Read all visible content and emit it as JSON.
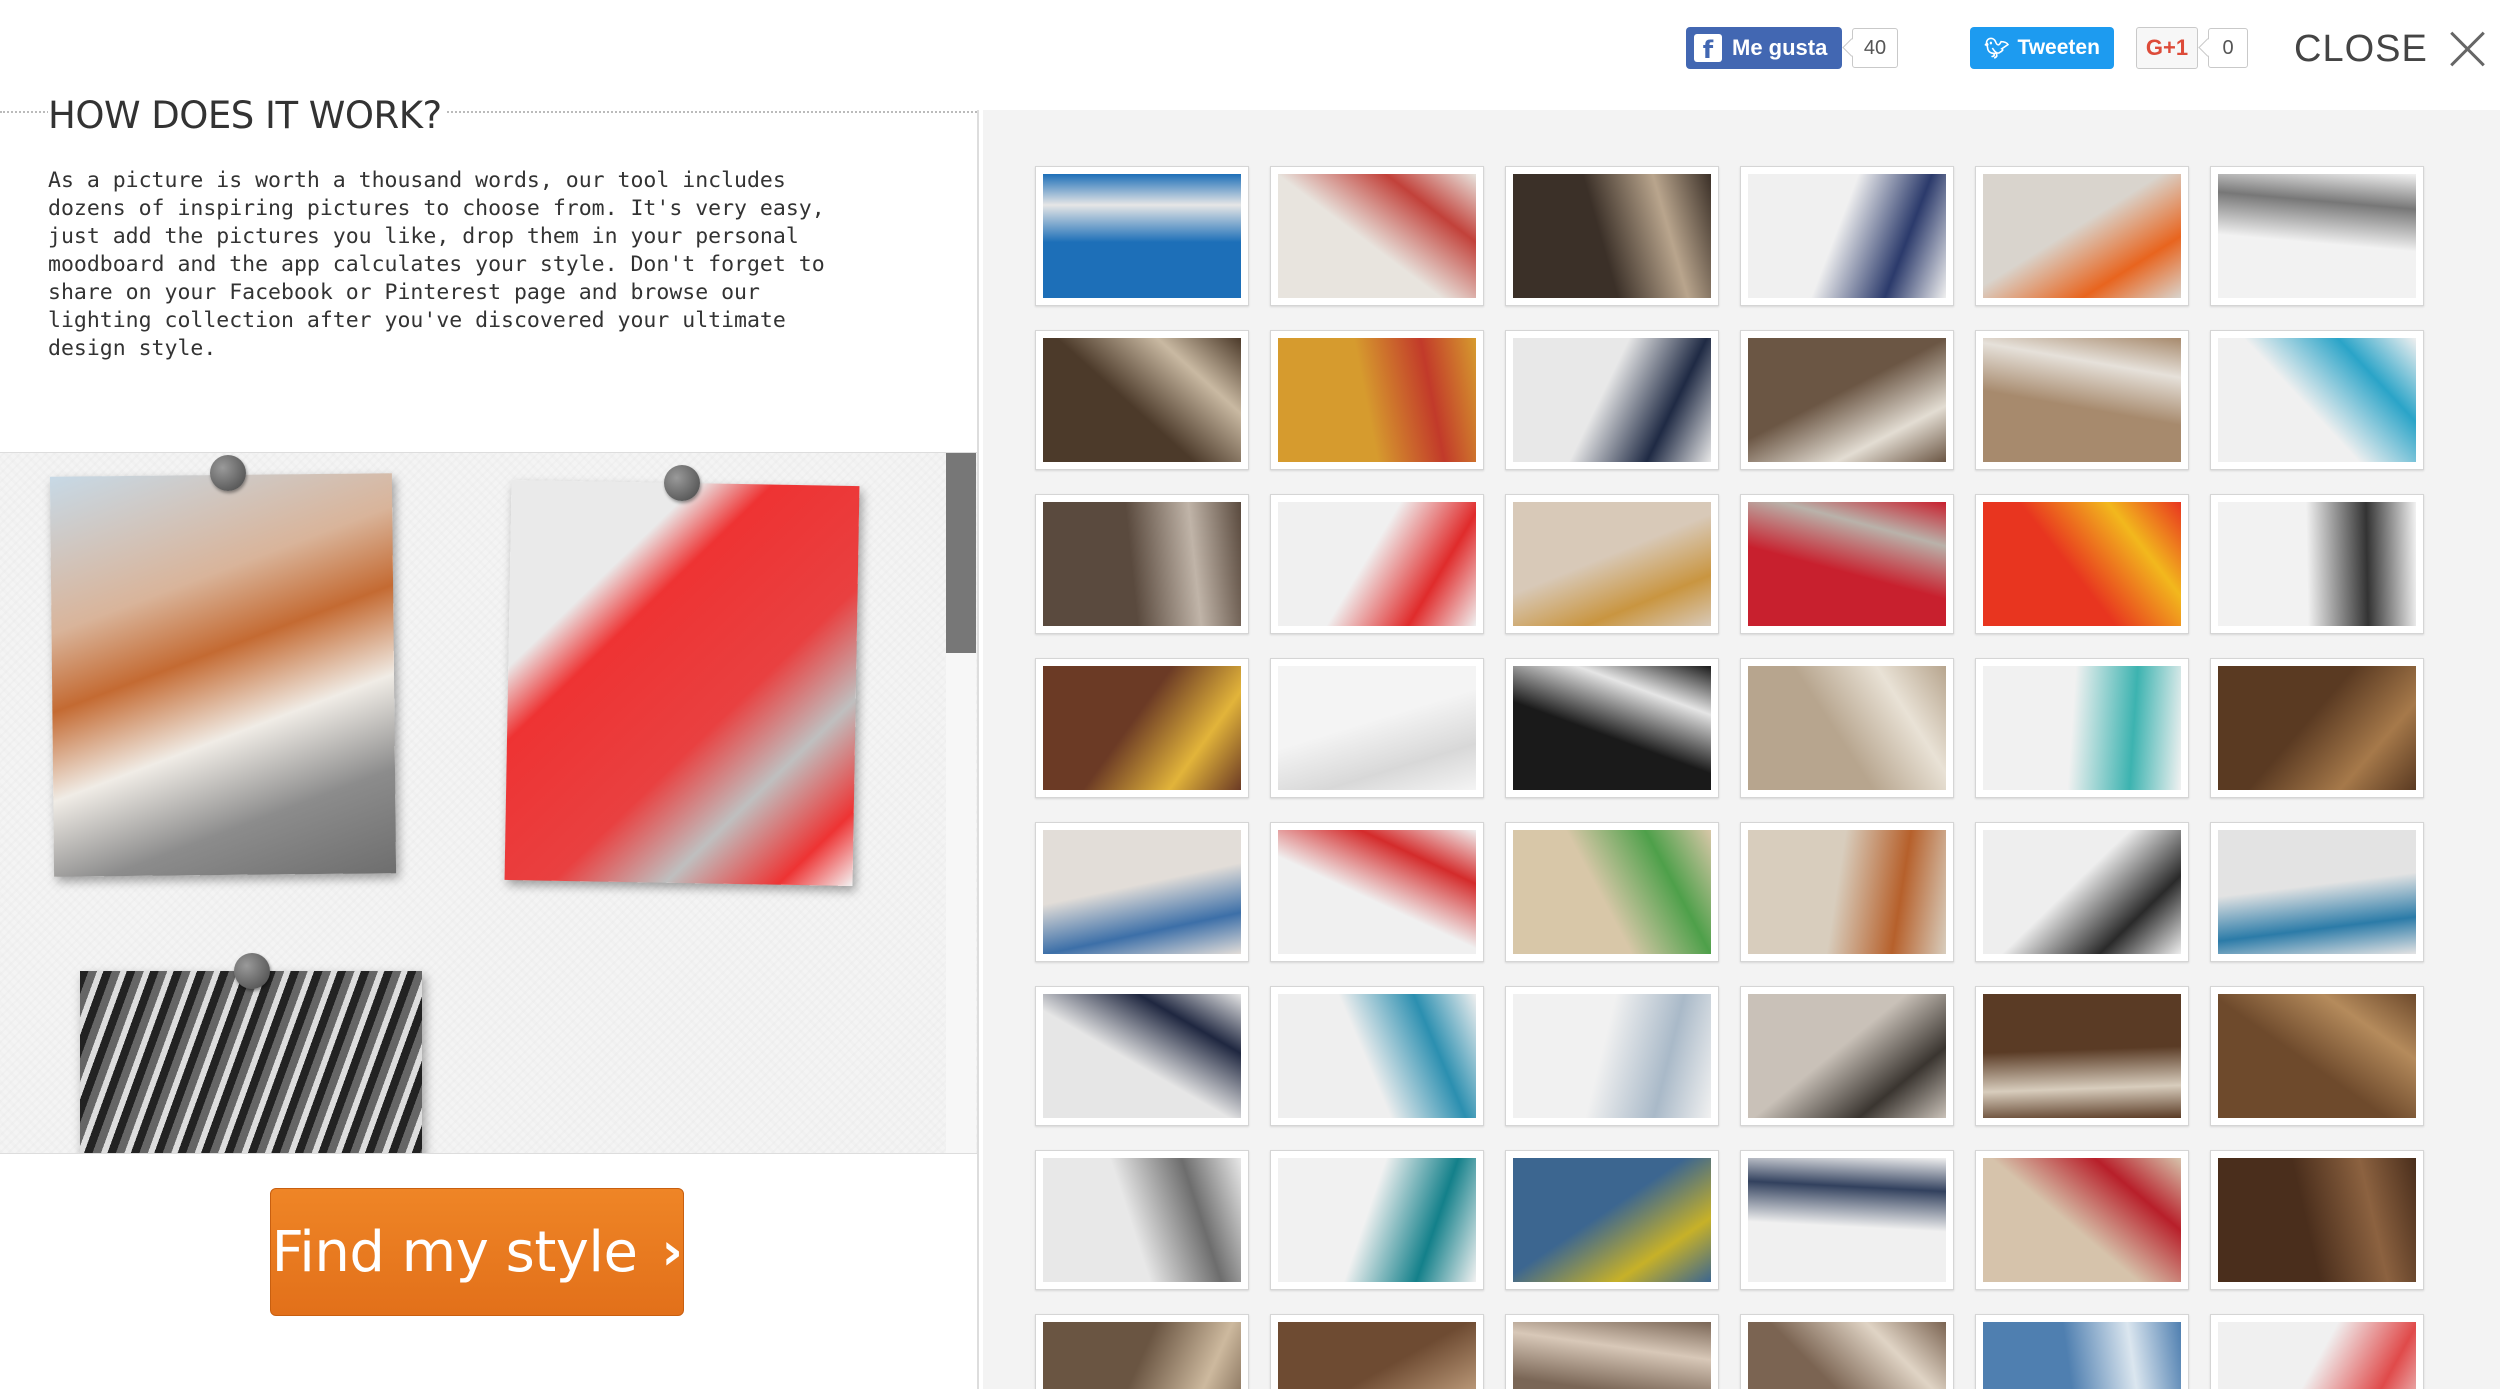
{
  "social": {
    "facebook": {
      "label": "Me gusta",
      "count": "40",
      "icon": "facebook-icon",
      "color": "#4267b2"
    },
    "twitter": {
      "label": "Tweeten",
      "icon": "twitter-bird-icon",
      "color": "#1d9bf0"
    },
    "googleplus": {
      "label": "G+1",
      "count": "0",
      "color": "#dd4b39"
    }
  },
  "close": {
    "label": "CLOSE",
    "icon": "close-icon"
  },
  "intro": {
    "title": "HOW DOES IT WORK?",
    "text": "As a picture is worth a thousand words, our tool includes dozens of inspiring pictures to choose from. It's very easy, just add the pictures you like, drop them in your personal moodboard and the app calculates your style. Don't forget to share on your Facebook or Pinterest page and browse our lighting collection after you've discovered your ultimate design style."
  },
  "moodboard": {
    "cards": [
      "leather-chair-blanket",
      "red-notebook-desk",
      "black-grey-chair-detail"
    ]
  },
  "cta": {
    "label": "Find my style",
    "icon": "chevron-right-icon",
    "color": "#e8781f"
  },
  "gallery": {
    "items": [
      {
        "name": "blue-towels",
        "c1": "#1d6fb8",
        "c2": "#e6e6e6"
      },
      {
        "name": "living-room-red",
        "c1": "#e8e4de",
        "c2": "#c2413a"
      },
      {
        "name": "dark-hallway-man",
        "c1": "#3b3028",
        "c2": "#b9a58d"
      },
      {
        "name": "woman-white-kitchen",
        "c1": "#f0f0f0",
        "c2": "#2b3a6b"
      },
      {
        "name": "family-orange-chair",
        "c1": "#d9d4cd",
        "c2": "#e8641e"
      },
      {
        "name": "bright-corridor",
        "c1": "#f2f2f2",
        "c2": "#777777"
      },
      {
        "name": "woman-reading-shelves",
        "c1": "#4c3a2a",
        "c2": "#c9b9a2"
      },
      {
        "name": "girl-headphones",
        "c1": "#d69b2e",
        "c2": "#c23a2a"
      },
      {
        "name": "woman-dark-sweater",
        "c1": "#e8e8e8",
        "c2": "#1f2a44"
      },
      {
        "name": "couple-living-room",
        "c1": "#6b5644",
        "c2": "#e3ddd3"
      },
      {
        "name": "couple-white-sofa",
        "c1": "#a78a6d",
        "c2": "#e6e1da"
      },
      {
        "name": "woman-white-sofa",
        "c1": "#f0f0f0",
        "c2": "#2aa4c8"
      },
      {
        "name": "candle-coins",
        "c1": "#5a4a3e",
        "c2": "#c0b4a8"
      },
      {
        "name": "red-desk-objects",
        "c1": "#f0f0f0",
        "c2": "#e02b2b"
      },
      {
        "name": "women-hats",
        "c1": "#d8c9b8",
        "c2": "#c99540"
      },
      {
        "name": "red-knit-blanket",
        "c1": "#c8202e",
        "c2": "#b9b2aa"
      },
      {
        "name": "yellow-mug-red-tray",
        "c1": "#e8351f",
        "c2": "#f2b81d"
      },
      {
        "name": "white-room-window",
        "c1": "#f2f2f2",
        "c2": "#333333"
      },
      {
        "name": "father-son-blanket",
        "c1": "#6b3a25",
        "c2": "#e2b43a"
      },
      {
        "name": "white-cabinet",
        "c1": "#f4f4f4",
        "c2": "#d8d8d8"
      },
      {
        "name": "woman-black-floor",
        "c1": "#1a1a1a",
        "c2": "#e5e5e5"
      },
      {
        "name": "couple-cream-sofa",
        "c1": "#b7a58e",
        "c2": "#e9e2d6"
      },
      {
        "name": "teal-globe-shelf",
        "c1": "#f1f1f1",
        "c2": "#3cb3b0"
      },
      {
        "name": "library-ladder",
        "c1": "#5a3a22",
        "c2": "#a6794a"
      },
      {
        "name": "couple-hug",
        "c1": "#e2ddd8",
        "c2": "#3c6fa8"
      },
      {
        "name": "red-white-desk",
        "c1": "#f0f0f0",
        "c2": "#d42b2b"
      },
      {
        "name": "kids-reading-book",
        "c1": "#d8c7a8",
        "c2": "#4ea04a"
      },
      {
        "name": "man-orange-sofa",
        "c1": "#d8cdbd",
        "c2": "#b6602b"
      },
      {
        "name": "man-dark-doorway",
        "c1": "#eeeeee",
        "c2": "#2a2a2a"
      },
      {
        "name": "mother-son-floor",
        "c1": "#e3e3e3",
        "c2": "#2b7ba8"
      },
      {
        "name": "woman-sitting-book",
        "c1": "#e6e6e6",
        "c2": "#1f2740"
      },
      {
        "name": "girl-blue-table",
        "c1": "#efefef",
        "c2": "#2b8fb0"
      },
      {
        "name": "kids-white-hall",
        "c1": "#f1f1f1",
        "c2": "#a9b9c8"
      },
      {
        "name": "couple-laughing",
        "c1": "#c9c1b8",
        "c2": "#3a3530"
      },
      {
        "name": "woman-reading-chair",
        "c1": "#5a3b25",
        "c2": "#d8cdbd"
      },
      {
        "name": "wooden-staircase",
        "c1": "#6e4a2c",
        "c2": "#b58b5c"
      },
      {
        "name": "woman-smiling-grey",
        "c1": "#e8e8e8",
        "c2": "#6d6d6d"
      },
      {
        "name": "teal-shelf-desk",
        "c1": "#f1f1f1",
        "c2": "#13808a"
      },
      {
        "name": "denim-yellow-knit",
        "c1": "#3c6690",
        "c2": "#c7b128"
      },
      {
        "name": "couple-white-room",
        "c1": "#f0f0f0",
        "c2": "#32415e"
      },
      {
        "name": "family-red-sweater",
        "c1": "#d6c3ab",
        "c2": "#b81f2a"
      },
      {
        "name": "wooden-doors",
        "c1": "#4a2e1c",
        "c2": "#8c6240"
      },
      {
        "name": "dining-chandelier",
        "c1": "#6a5542",
        "c2": "#cdb99e"
      },
      {
        "name": "wooden-bowl-table",
        "c1": "#6e4b32",
        "c2": "#b69474"
      },
      {
        "name": "fireplace-room",
        "c1": "#7a6656",
        "c2": "#d8c8b8"
      },
      {
        "name": "couple-reading-sofa",
        "c1": "#7b6452",
        "c2": "#e0d4c5"
      },
      {
        "name": "boy-tablet",
        "c1": "#4f7fb0",
        "c2": "#dbe6ef"
      },
      {
        "name": "girl-white-kitchen",
        "c1": "#f0f0f0",
        "c2": "#e04a4a"
      }
    ]
  }
}
